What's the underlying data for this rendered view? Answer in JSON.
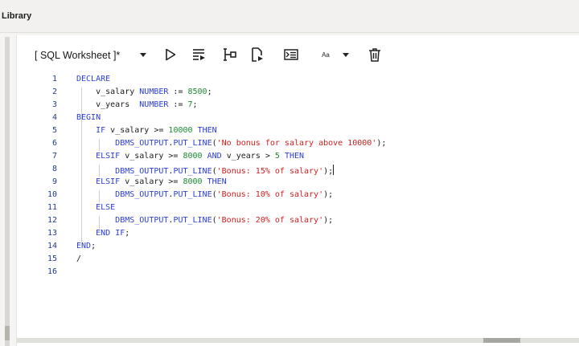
{
  "header": {
    "title": "Library"
  },
  "worksheet": {
    "tab_label": "[ SQL Worksheet ]*",
    "toolbar": {
      "icons": [
        "tab-menu-chevron",
        "run-statement",
        "run-script",
        "explain-plan",
        "autotrace",
        "dbms-output",
        "format",
        "format-menu-chevron",
        "clear"
      ],
      "format_label": "Aa"
    }
  },
  "editor": {
    "lines": [
      {
        "n": "1",
        "code": "DECLARE"
      },
      {
        "n": "2",
        "code": "    v_salary NUMBER := 8500;"
      },
      {
        "n": "3",
        "code": "    v_years  NUMBER := 7;"
      },
      {
        "n": "4",
        "code": "BEGIN"
      },
      {
        "n": "5",
        "code": "    IF v_salary >= 10000 THEN"
      },
      {
        "n": "6",
        "code": "        DBMS_OUTPUT.PUT_LINE('No bonus for salary above 10000');"
      },
      {
        "n": "7",
        "code": "    ELSIF v_salary >= 8000 AND v_years > 5 THEN"
      },
      {
        "n": "8",
        "code": "        DBMS_OUTPUT.PUT_LINE('Bonus: 15% of salary');"
      },
      {
        "n": "9",
        "code": "    ELSIF v_salary >= 8000 THEN"
      },
      {
        "n": "10",
        "code": "        DBMS_OUTPUT.PUT_LINE('Bonus: 10% of salary');"
      },
      {
        "n": "11",
        "code": "    ELSE"
      },
      {
        "n": "12",
        "code": "        DBMS_OUTPUT.PUT_LINE('Bonus: 20% of salary');"
      },
      {
        "n": "13",
        "code": "    END IF;"
      },
      {
        "n": "14",
        "code": "END;"
      },
      {
        "n": "15",
        "code": "/"
      },
      {
        "n": "16",
        "code": ""
      }
    ],
    "cursor_line": "8"
  },
  "colors": {
    "keyword": "#2d3fd1",
    "number": "#1e8a34",
    "string": "#cc1e1e",
    "line_number": "#1f3a8a"
  }
}
